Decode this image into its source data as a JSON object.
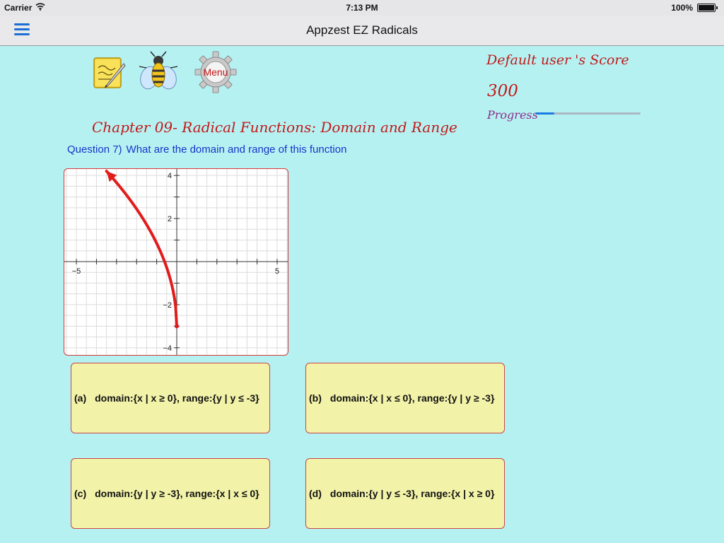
{
  "status_bar": {
    "carrier": "Carrier",
    "time": "7:13 PM",
    "battery": "100%"
  },
  "nav": {
    "title": "Appzest EZ Radicals",
    "menu_icon": "hamburger-icon"
  },
  "toolbar": {
    "notes_icon": "notepad-icon",
    "bee_icon": "bee-icon",
    "menu_icon": "gear-icon",
    "menu_label": "Menu"
  },
  "score": {
    "title": "Default user 's Score",
    "value": "300",
    "progress_label": "Progress",
    "progress_fraction": 0.18
  },
  "chapter_title": "Chapter 09- Radical Functions: Domain and Range",
  "question": {
    "number": "Question 7)",
    "text": "What are the domain and range of this function"
  },
  "graph": {
    "x_ticks": [
      {
        "value": -5,
        "label": "−5"
      },
      {
        "value": 5,
        "label": "5"
      }
    ],
    "y_ticks": [
      {
        "value": 4,
        "label": "4"
      },
      {
        "value": 2,
        "label": "2"
      },
      {
        "value": -2,
        "label": "−2"
      },
      {
        "value": -4,
        "label": "−4"
      }
    ],
    "xlim": [
      -5.6,
      5.6
    ],
    "ylim": [
      -4.4,
      4.3
    ],
    "curve_color": "#e21b1b",
    "start_point": [
      0,
      -3
    ],
    "end_point": [
      -3.5,
      4.2
    ]
  },
  "answers": [
    {
      "letter": "(a)",
      "text": "domain:{x | x ≥ 0}, range:{y | y ≤ -3}"
    },
    {
      "letter": "(b)",
      "text": "domain:{x | x ≤ 0}, range:{y | y ≥ -3}"
    },
    {
      "letter": "(c)",
      "text": "domain:{y | y ≥ -3}, range:{x | x ≤ 0}"
    },
    {
      "letter": "(d)",
      "text": "domain:{y | y ≤ -3}, range:{x | x ≥ 0}"
    }
  ]
}
